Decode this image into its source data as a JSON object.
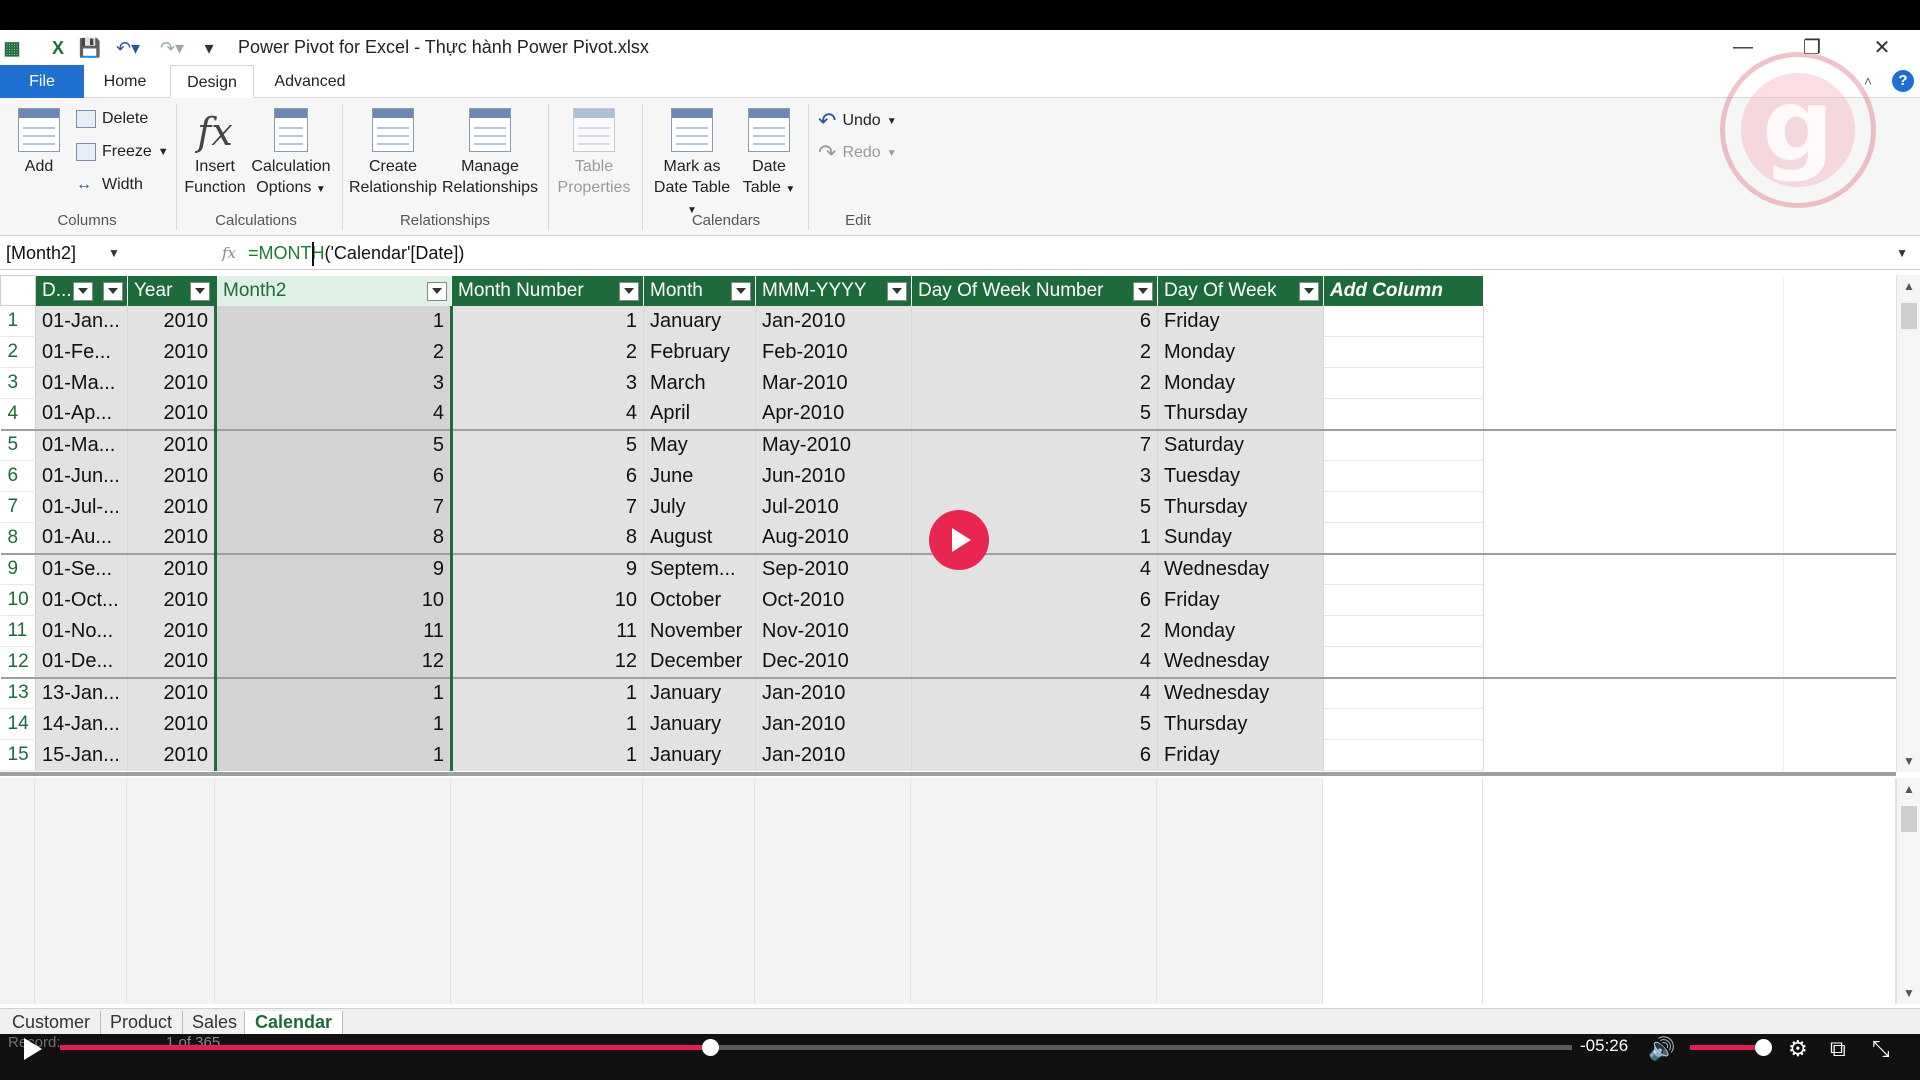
{
  "window": {
    "title": "Power Pivot for Excel - Thực hành Power Pivot.xlsx"
  },
  "tabs": [
    {
      "label": "File"
    },
    {
      "label": "Home"
    },
    {
      "label": "Design"
    },
    {
      "label": "Advanced"
    }
  ],
  "ribbon": {
    "columns": {
      "add": "Add",
      "delete": "Delete",
      "freeze": "Freeze",
      "width": "Width",
      "group": "Columns"
    },
    "calculations": {
      "insert_line1": "Insert",
      "insert_line2": "Function",
      "calc_line1": "Calculation",
      "calc_line2": "Options",
      "group": "Calculations"
    },
    "relationships": {
      "create_line1": "Create",
      "create_line2": "Relationship",
      "manage_line1": "Manage",
      "manage_line2": "Relationships",
      "group": "Relationships"
    },
    "table": {
      "line1": "Table",
      "line2": "Properties"
    },
    "calendars": {
      "mark_line1": "Mark as",
      "mark_line2": "Date Table",
      "date_line1": "Date",
      "date_line2": "Table",
      "group": "Calendars"
    },
    "edit": {
      "undo": "Undo",
      "redo": "Redo",
      "group": "Edit"
    }
  },
  "formula_bar": {
    "name_box": "[Month2]",
    "fx": "fx",
    "formula_fn": "=MONTH",
    "formula_args": "('Calendar'[Date])"
  },
  "grid": {
    "headers": [
      "D...",
      "Year",
      "Month2",
      "Month Number",
      "Month",
      "MMM-YYYY",
      "Day Of Week Number",
      "Day Of Week",
      "Add Column"
    ],
    "rows": [
      {
        "n": "1",
        "date": "01-Jan...",
        "year": "2010",
        "month2": "1",
        "mnum": "1",
        "month": "January",
        "mmm": "Jan-2010",
        "dow_num": "6",
        "dow": "Friday"
      },
      {
        "n": "2",
        "date": "01-Fe...",
        "year": "2010",
        "month2": "2",
        "mnum": "2",
        "month": "February",
        "mmm": "Feb-2010",
        "dow_num": "2",
        "dow": "Monday"
      },
      {
        "n": "3",
        "date": "01-Ma...",
        "year": "2010",
        "month2": "3",
        "mnum": "3",
        "month": "March",
        "mmm": "Mar-2010",
        "dow_num": "2",
        "dow": "Monday"
      },
      {
        "n": "4",
        "date": "01-Ap...",
        "year": "2010",
        "month2": "4",
        "mnum": "4",
        "month": "April",
        "mmm": "Apr-2010",
        "dow_num": "5",
        "dow": "Thursday"
      },
      {
        "n": "5",
        "date": "01-Ma...",
        "year": "2010",
        "month2": "5",
        "mnum": "5",
        "month": "May",
        "mmm": "May-2010",
        "dow_num": "7",
        "dow": "Saturday"
      },
      {
        "n": "6",
        "date": "01-Jun...",
        "year": "2010",
        "month2": "6",
        "mnum": "6",
        "month": "June",
        "mmm": "Jun-2010",
        "dow_num": "3",
        "dow": "Tuesday"
      },
      {
        "n": "7",
        "date": "01-Jul-...",
        "year": "2010",
        "month2": "7",
        "mnum": "7",
        "month": "July",
        "mmm": "Jul-2010",
        "dow_num": "5",
        "dow": "Thursday"
      },
      {
        "n": "8",
        "date": "01-Au...",
        "year": "2010",
        "month2": "8",
        "mnum": "8",
        "month": "August",
        "mmm": "Aug-2010",
        "dow_num": "1",
        "dow": "Sunday"
      },
      {
        "n": "9",
        "date": "01-Se...",
        "year": "2010",
        "month2": "9",
        "mnum": "9",
        "month": "Septem...",
        "mmm": "Sep-2010",
        "dow_num": "4",
        "dow": "Wednesday"
      },
      {
        "n": "10",
        "date": "01-Oct...",
        "year": "2010",
        "month2": "10",
        "mnum": "10",
        "month": "October",
        "mmm": "Oct-2010",
        "dow_num": "6",
        "dow": "Friday"
      },
      {
        "n": "11",
        "date": "01-No...",
        "year": "2010",
        "month2": "11",
        "mnum": "11",
        "month": "November",
        "mmm": "Nov-2010",
        "dow_num": "2",
        "dow": "Monday"
      },
      {
        "n": "12",
        "date": "01-De...",
        "year": "2010",
        "month2": "12",
        "mnum": "12",
        "month": "December",
        "mmm": "Dec-2010",
        "dow_num": "4",
        "dow": "Wednesday"
      },
      {
        "n": "13",
        "date": "13-Jan...",
        "year": "2010",
        "month2": "1",
        "mnum": "1",
        "month": "January",
        "mmm": "Jan-2010",
        "dow_num": "4",
        "dow": "Wednesday"
      },
      {
        "n": "14",
        "date": "14-Jan...",
        "year": "2010",
        "month2": "1",
        "mnum": "1",
        "month": "January",
        "mmm": "Jan-2010",
        "dow_num": "5",
        "dow": "Thursday"
      },
      {
        "n": "15",
        "date": "15-Jan...",
        "year": "2010",
        "month2": "1",
        "mnum": "1",
        "month": "January",
        "mmm": "Jan-2010",
        "dow_num": "6",
        "dow": "Friday"
      }
    ]
  },
  "sheet_tabs": [
    {
      "label": "Customer"
    },
    {
      "label": "Product"
    },
    {
      "label": "Sales"
    },
    {
      "label": "Calendar"
    }
  ],
  "record": {
    "label": "Record:",
    "count": "1 of 365"
  },
  "video": {
    "time": "-05:26",
    "progress_fraction": 0.43,
    "volume_fraction": 0.85
  }
}
